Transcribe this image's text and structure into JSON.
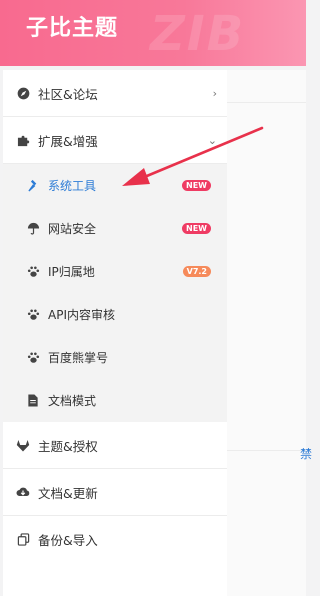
{
  "header": {
    "title": "子比主题",
    "watermark": "ZIB"
  },
  "menu": {
    "items": [
      {
        "label": "社区&论坛",
        "icon": "compass-icon",
        "chevron": "›"
      },
      {
        "label": "扩展&增强",
        "icon": "puzzle-icon",
        "chevron": "⌄"
      },
      {
        "label": "主题&授权",
        "icon": "gitlab-icon"
      },
      {
        "label": "文档&更新",
        "icon": "cloud-download-icon"
      },
      {
        "label": "备份&导入",
        "icon": "copy-icon"
      }
    ],
    "submenu": [
      {
        "label": "系统工具",
        "icon": "hammer-icon",
        "badge": "NEW",
        "active": true
      },
      {
        "label": "网站安全",
        "icon": "umbrella-icon",
        "badge": "NEW"
      },
      {
        "label": "IP归属地",
        "icon": "paw-icon",
        "badge": "V7.2"
      },
      {
        "label": "API内容审核",
        "icon": "paw-icon"
      },
      {
        "label": "百度熊掌号",
        "icon": "paw-icon"
      },
      {
        "label": "文档模式",
        "icon": "file-icon"
      }
    ]
  },
  "content": {
    "fragment": "禁"
  },
  "colors": {
    "accent": "#f86a8f",
    "active": "#2d7cd6",
    "badge_new": "#ef3b63",
    "badge_ver": "#f68a5a",
    "arrow": "#e8314b"
  }
}
